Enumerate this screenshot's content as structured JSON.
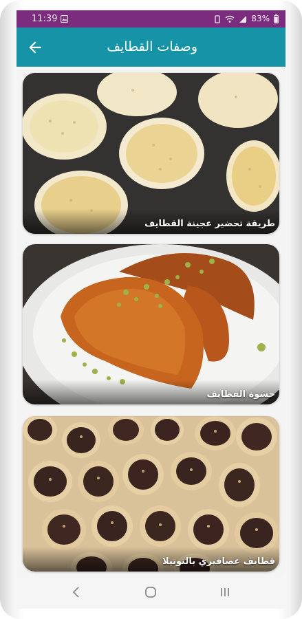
{
  "status_bar": {
    "time": "11:39",
    "battery": "83%",
    "icons": [
      "gallery-icon",
      "vibrate-icon",
      "wifi-icon",
      "signal-icon",
      "battery-icon"
    ]
  },
  "app_bar": {
    "title": "وصفات القطايف",
    "back_icon": "arrow-back-icon",
    "color": "#1793a8"
  },
  "cards": [
    {
      "caption": "طريقة تحضير عجينة القطايف",
      "image": "pancakes-on-griddle"
    },
    {
      "caption": "حشوة القطايف",
      "image": "fried-qatayef-with-pistachio"
    },
    {
      "caption": "قطايف عصافيري بالنوتيلا",
      "image": "qatayef-cones-with-nutella"
    }
  ],
  "nav_bar": {
    "buttons": [
      "back-nav-icon",
      "home-nav-icon",
      "recents-nav-icon"
    ]
  },
  "colors": {
    "status_bar": "#7b2c7e",
    "app_bar": "#1793a8"
  }
}
